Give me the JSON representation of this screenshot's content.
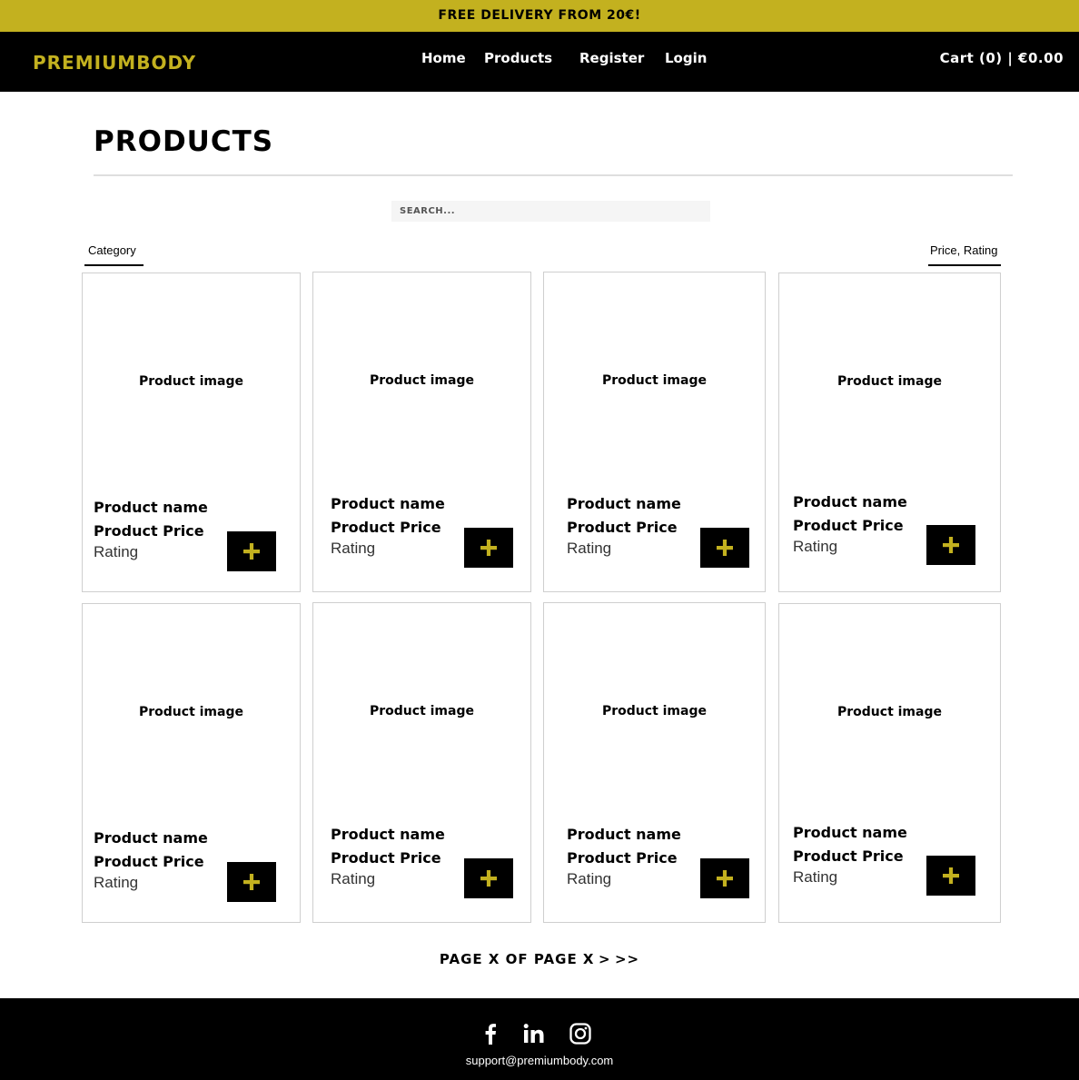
{
  "promo": {
    "text": "FREE DELIVERY FROM 20€!"
  },
  "header": {
    "brand": "PREMIUMBODY",
    "nav": [
      "Home",
      "Products",
      "Register",
      "Login"
    ],
    "cart": "Cart (0) | €0.00"
  },
  "page": {
    "title": "PRODUCTS",
    "search_placeholder": "SEARCH...",
    "filter_category": "Category",
    "filter_sort": "Price, Rating"
  },
  "products": [
    {
      "image": "Product image",
      "name": "Product name",
      "price": "Product Price",
      "rating": "Rating",
      "add_icon": "plus-icon"
    },
    {
      "image": "Product image",
      "name": "Product name",
      "price": "Product Price",
      "rating": "Rating",
      "add_icon": "plus-icon"
    },
    {
      "image": "Product image",
      "name": "Product name",
      "price": "Product Price",
      "rating": "Rating",
      "add_icon": "plus-icon"
    },
    {
      "image": "Product image",
      "name": "Product name",
      "price": "Product Price",
      "rating": "Rating",
      "add_icon": "plus-icon"
    },
    {
      "image": "Product image",
      "name": "Product name",
      "price": "Product Price",
      "rating": "Rating",
      "add_icon": "plus-icon"
    },
    {
      "image": "Product image",
      "name": "Product name",
      "price": "Product Price",
      "rating": "Rating",
      "add_icon": "plus-icon"
    },
    {
      "image": "Product image",
      "name": "Product name",
      "price": "Product Price",
      "rating": "Rating",
      "add_icon": "plus-icon"
    },
    {
      "image": "Product image",
      "name": "Product name",
      "price": "Product Price",
      "rating": "Rating",
      "add_icon": "plus-icon"
    }
  ],
  "pagination": {
    "text": "PAGE X OF PAGE X",
    "next": ">",
    "last": ">>"
  },
  "footer": {
    "social_icons": [
      "facebook-icon",
      "linkedin-icon",
      "instagram-icon"
    ],
    "email": "support@premiumbody.com"
  },
  "colors": {
    "accent": "#c3b11f",
    "dark": "#000000",
    "card_border": "#cfcfcf"
  }
}
